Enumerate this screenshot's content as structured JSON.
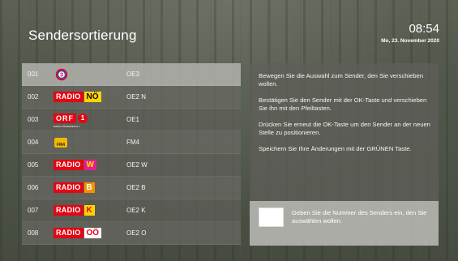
{
  "header": {
    "title": "Sendersortierung",
    "time": "08:54",
    "date": "Mo, 23. November 2020"
  },
  "channels": [
    {
      "number": "001",
      "name": "OE3",
      "logo": "oe3-logo",
      "selected": true
    },
    {
      "number": "002",
      "name": "OE2 N",
      "logo": "radio-noe-logo",
      "logo_text": [
        "RADIO",
        "NÖ"
      ]
    },
    {
      "number": "003",
      "name": "OE1",
      "logo": "orf1-logo",
      "logo_text": [
        "ORF",
        "1",
        "RADIO ÖSTERREICH 1"
      ]
    },
    {
      "number": "004",
      "name": "FM4",
      "logo": "fm4-logo",
      "logo_text": [
        "FM4"
      ]
    },
    {
      "number": "005",
      "name": "OE2 W",
      "logo": "radio-wien-logo",
      "logo_text": [
        "RADIO",
        "W"
      ]
    },
    {
      "number": "006",
      "name": "OE2 B",
      "logo": "radio-burgenland-logo",
      "logo_text": [
        "RADIO",
        "B"
      ]
    },
    {
      "number": "007",
      "name": "OE2 K",
      "logo": "radio-kaernten-logo",
      "logo_text": [
        "RADIO",
        "K"
      ]
    },
    {
      "number": "008",
      "name": "OE2 O",
      "logo": "radio-ooe-logo",
      "logo_text": [
        "RADIO",
        "OÖ"
      ]
    }
  ],
  "info": {
    "p1": "Bewegen Sie die Auswahl zum Sender, den Sie verschieben wollen.",
    "p2": "Bestätigen Sie den Sender mit der OK-Taste und verschieben Sie ihn mit den Pfeiltasten.",
    "p3": "Drücken Sie erneut die OK-Taste um den Sender an der neuen Stelle zu positionieren.",
    "p4": "Speichern Sie Ihre Änderungen mit der GRÜNEN Taste."
  },
  "number_input": {
    "value": "",
    "hint": "Geben Sie die Nummer des Senders ein, den Sie auswählen wollen."
  },
  "colors": {
    "radio_red": "#e30613",
    "noe_yellow": "#ffd400",
    "wien_magenta": "#e31f8f",
    "burgenland_orange": "#f39200"
  }
}
